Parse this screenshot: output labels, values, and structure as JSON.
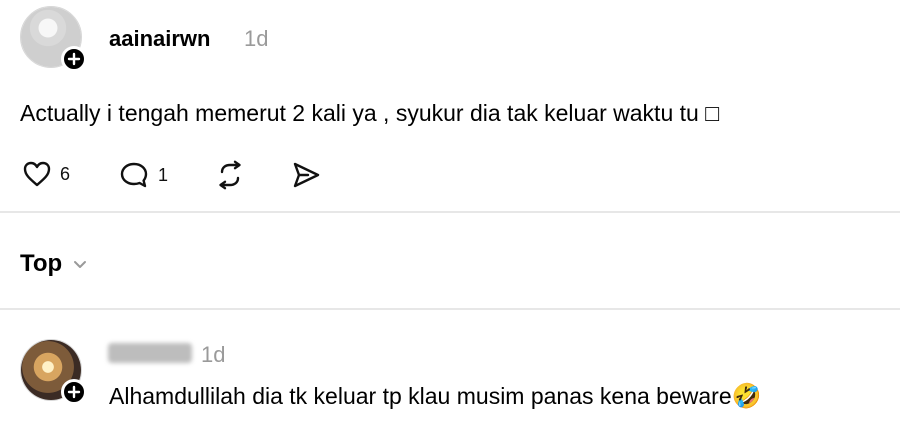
{
  "post": {
    "username": "aainairwn",
    "time": "1d",
    "text": "Actually i tengah memerut 2 kali ya , syukur dia tak keluar waktu tu □",
    "likes": "6",
    "replies": "1"
  },
  "sort": {
    "label": "Top"
  },
  "reply": {
    "time": "1d",
    "text": "Alhamdullilah dia tk keluar tp klau musim panas kena beware",
    "emoji": "🤣"
  },
  "icons": {
    "like": "heart-icon",
    "reply": "comment-icon",
    "repost": "repost-icon",
    "share": "share-icon",
    "follow": "plus-icon",
    "sort": "chevron-down-icon"
  }
}
